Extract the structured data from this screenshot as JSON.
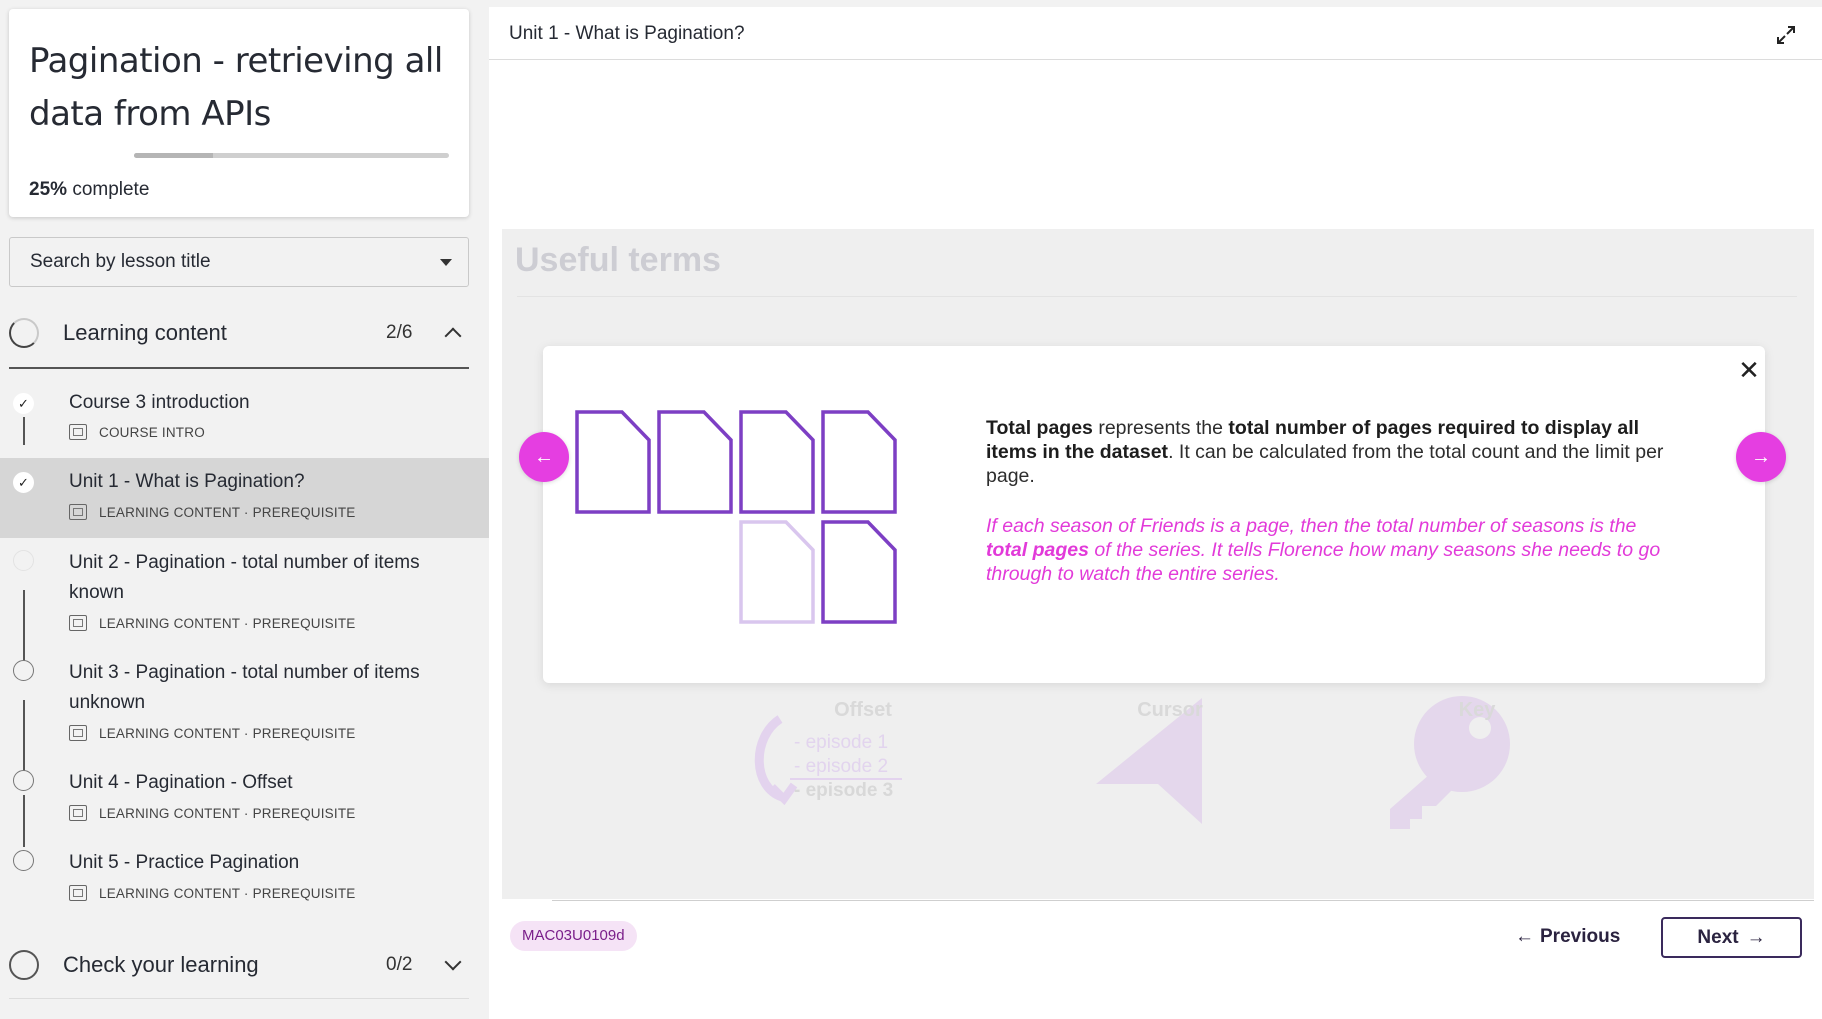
{
  "course": {
    "title": "Pagination - retrieving all data from APIs",
    "progress_percent": 25,
    "progress_value": "25%",
    "progress_suffix": "complete"
  },
  "search": {
    "placeholder": "Search by lesson title"
  },
  "sections": [
    {
      "label": "Learning content",
      "count": "2/6",
      "expanded": true
    },
    {
      "label": "Check your learning",
      "count": "0/2",
      "expanded": false
    }
  ],
  "lessons": [
    {
      "title": "Course 3 introduction",
      "meta": "COURSE INTRO",
      "done": true
    },
    {
      "title": "Unit 1 - What is Pagination?",
      "meta": "LEARNING CONTENT · PREREQUISITE",
      "done": true,
      "active": true
    },
    {
      "title": "Unit 2 - Pagination - total number of items known",
      "meta": "LEARNING CONTENT · PREREQUISITE",
      "done": false
    },
    {
      "title": "Unit 3 - Pagination - total number of items unknown",
      "meta": "LEARNING CONTENT · PREREQUISITE",
      "done": false
    },
    {
      "title": "Unit 4 - Pagination - Offset",
      "meta": "LEARNING CONTENT · PREREQUISITE",
      "done": false
    },
    {
      "title": "Unit 5 - Practice Pagination",
      "meta": "LEARNING CONTENT · PREREQUISITE",
      "done": false
    }
  ],
  "main": {
    "unit_title": "Unit 1 - What is Pagination?",
    "stage_heading": "Useful terms",
    "background_items": [
      "Offset",
      "Cursor",
      "Key"
    ],
    "episodes": [
      "- episode 1",
      "- episode 2",
      "- episode 3"
    ]
  },
  "modal": {
    "t1": "Total pages",
    "t2": " represents the ",
    "t3": "total number of pages required to display all items in the dataset",
    "t4": ". It can be calculated from the total count and the limit per page.",
    "e1": "If each season of Friends is a page, then the total number of seasons is the ",
    "e2": "total pages",
    "e3": " of the series. It tells Florence how many seasons she needs to go through to watch the entire series."
  },
  "footer": {
    "code": "MAC03U0109d",
    "prev_label": "Previous",
    "next_label": "Next"
  },
  "colors": {
    "accent": "#e53ee1",
    "page_icon": "#7d3fc4",
    "page_icon_faint": "#d9c6ee",
    "badge_bg": "#f5e3f6"
  }
}
